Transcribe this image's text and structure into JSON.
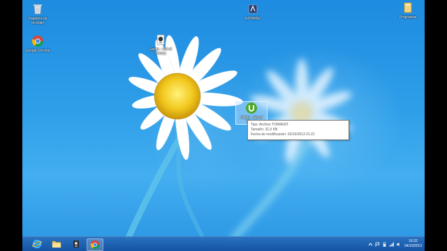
{
  "desktop_icons": [
    {
      "name": "recycle-bin",
      "label": "Papelera de reciclaje",
      "icon": "recycle-bin-icon"
    },
    {
      "name": "google-chrome",
      "label": "Google Chrome",
      "icon": "chrome-icon"
    },
    {
      "name": "torrent-file-1",
      "label": "Saints - Girl of Victory",
      "icon": "torrent-file-icon"
    },
    {
      "name": "nitman",
      "label": "NITMAN2",
      "icon": "app-icon"
    },
    {
      "name": "programas",
      "label": "Programas",
      "icon": "folder-icon"
    },
    {
      "name": "torrent-file-selected",
      "label": "Saints - Girl of Victory",
      "icon": "utorrent-icon"
    }
  ],
  "tooltip": {
    "type": "Tipo: Archivo TORRENT",
    "size": "Tamaño: 31,0 KB",
    "modified": "Fecha de modificación: 03/10/2013 21:21"
  },
  "taskbar": {
    "pinned": [
      {
        "name": "internet-explorer",
        "icon": "ie-icon"
      },
      {
        "name": "file-explorer",
        "icon": "folder-icon"
      },
      {
        "name": "pinned-app",
        "icon": "app-icon"
      },
      {
        "name": "chrome",
        "icon": "chrome-icon",
        "active": true
      }
    ],
    "clock": {
      "time": "16:32",
      "date": "04/10/2013"
    }
  }
}
